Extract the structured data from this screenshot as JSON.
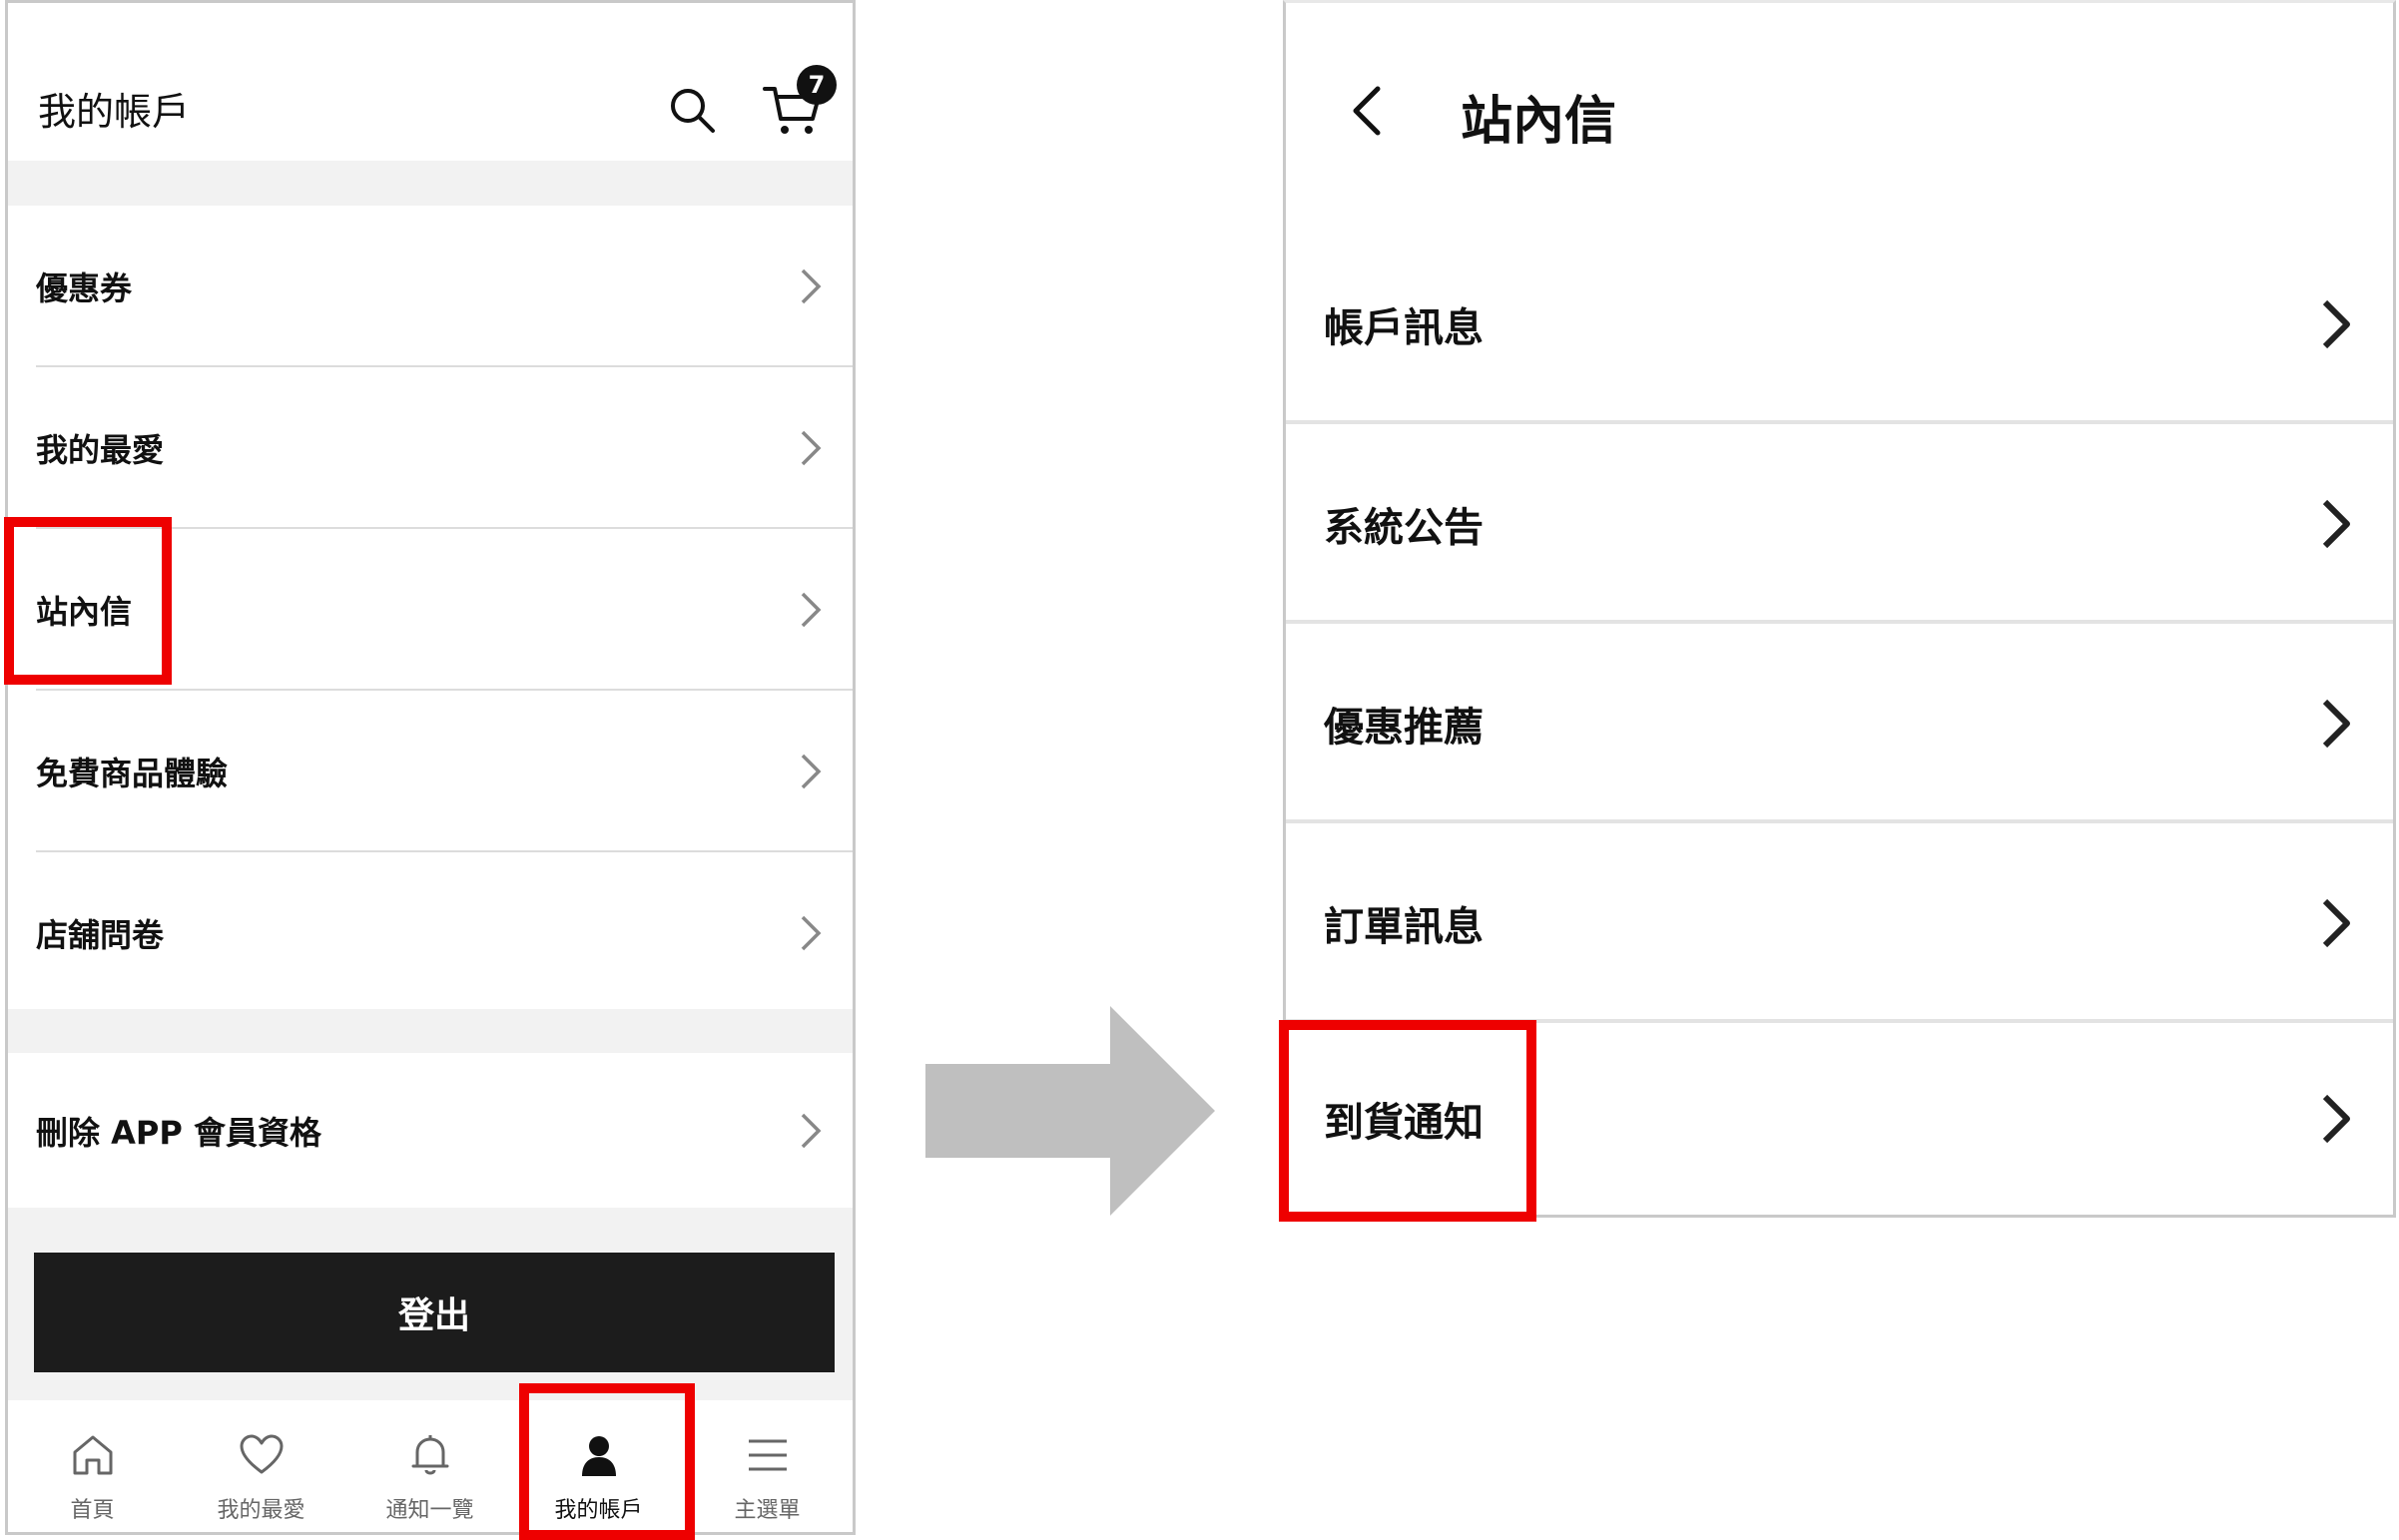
{
  "left": {
    "title": "我的帳戶",
    "cart_count": "7",
    "menu": [
      {
        "label": "優惠券"
      },
      {
        "label": "我的最愛"
      },
      {
        "label": "站內信"
      },
      {
        "label": "免費商品體驗"
      },
      {
        "label": "店舖問卷"
      }
    ],
    "menu_extra": {
      "label": "刪除 APP 會員資格"
    },
    "logout_label": "登出",
    "nav": [
      {
        "label": "首頁",
        "icon": "home-icon"
      },
      {
        "label": "我的最愛",
        "icon": "heart-icon"
      },
      {
        "label": "通知一覽",
        "icon": "bell-icon"
      },
      {
        "label": "我的帳戶",
        "icon": "person-icon",
        "active": true
      },
      {
        "label": "主選單",
        "icon": "hamburger-menu-icon"
      }
    ]
  },
  "right": {
    "title": "站內信",
    "items": [
      {
        "label": "帳戶訊息"
      },
      {
        "label": "系統公告"
      },
      {
        "label": "優惠推薦"
      },
      {
        "label": "訂單訊息"
      },
      {
        "label": "到貨通知"
      }
    ]
  },
  "colors": {
    "highlight": "#ee0000",
    "logout_bg": "#1c1c1c",
    "arrow": "#bfbfbf"
  }
}
